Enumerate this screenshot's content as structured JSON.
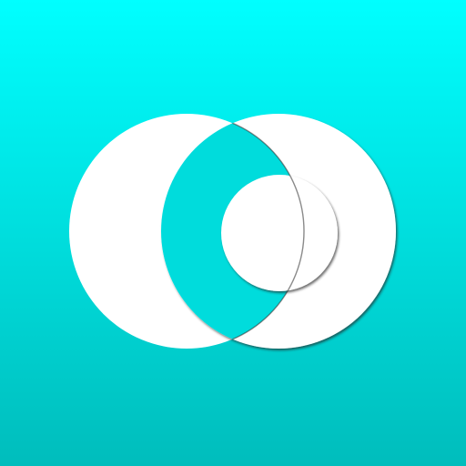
{
  "icon": {
    "name": "overlapping-circles-logo",
    "colors": {
      "background_top": "#00FFFF",
      "background_bottom": "#00BDBC",
      "foreground": "#FFFFFF",
      "outline_shadow": "#222222"
    }
  }
}
